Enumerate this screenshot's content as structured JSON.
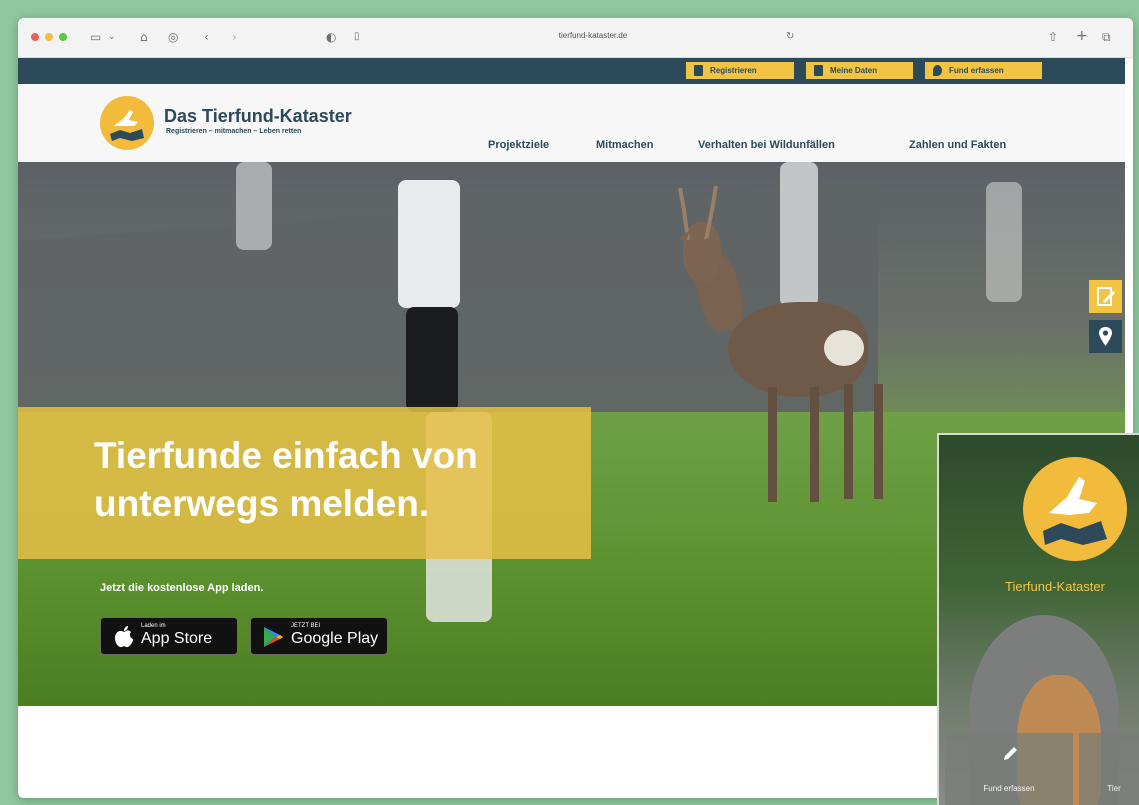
{
  "browser": {
    "url": "tierfund-kataster.de"
  },
  "topbar": {
    "buttons": [
      "Registrieren",
      "Meine Daten",
      "Fund erfassen"
    ]
  },
  "header": {
    "title": "Das Tierfund-Kataster",
    "subtitle": "Registrieren – mitmachen – Leben retten",
    "nav": [
      "Projektziele",
      "Mitmachen",
      "Verhalten bei Wildunfällen",
      "Zahlen und Fakten"
    ]
  },
  "hero": {
    "title": "Tierfunde einfach von unterwegs melden.",
    "subtitle": "Jetzt die kostenlose App laden.",
    "app_store": {
      "small": "Laden im",
      "big": "App Store"
    },
    "google_play": {
      "small": "JETZT BEI",
      "big": "Google Play"
    }
  },
  "phone": {
    "brand": "Tierfund-Kataster",
    "tiles": [
      "Fund erfassen",
      "Tier"
    ]
  },
  "colors": {
    "brand_dark": "#2c4a5a",
    "accent_yellow": "#f2c444"
  }
}
